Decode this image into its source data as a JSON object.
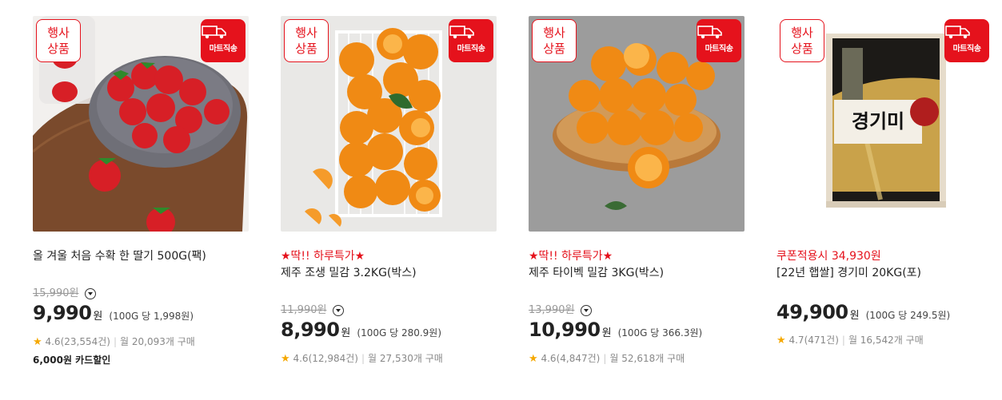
{
  "products": [
    {
      "event_badge": [
        "행사",
        "상품"
      ],
      "delivery_badge": "마트직송",
      "promo": "",
      "title": "올 겨울 처음 수확 한 딸기 500G(팩)",
      "original_price": "15,990원",
      "price": "9,990",
      "currency": "원",
      "unit_price": "(100G 당 1,998원)",
      "rating": "4.6(23,554건)",
      "purchases": "월 20,093개 구매",
      "card_discount": "6,000원 카드할인",
      "image": "strawberries"
    },
    {
      "event_badge": [
        "행사",
        "상품"
      ],
      "delivery_badge": "마트직송",
      "promo": "★딱!! 하루특가★",
      "title": "제주 조생 밀감 3.2KG(박스)",
      "original_price": "11,990원",
      "price": "8,990",
      "currency": "원",
      "unit_price": "(100G 당 280.9원)",
      "rating": "4.6(12,984건)",
      "purchases": "월 27,530개 구매",
      "card_discount": "",
      "image": "tangerines-basket"
    },
    {
      "event_badge": [
        "행사",
        "상품"
      ],
      "delivery_badge": "마트직송",
      "promo": "★딱!! 하루특가★",
      "title": "제주 타이벡 밀감 3KG(박스)",
      "original_price": "13,990원",
      "price": "10,990",
      "currency": "원",
      "unit_price": "(100G 당 366.3원)",
      "rating": "4.6(4,847건)",
      "purchases": "월 52,618개 구매",
      "card_discount": "",
      "image": "tangerines-board"
    },
    {
      "event_badge": [
        "행사",
        "상품"
      ],
      "delivery_badge": "마트직송",
      "promo": "쿠폰적용시 34,930원",
      "title": "[22년 햅쌀] 경기미 20KG(포)",
      "original_price": "",
      "price": "49,900",
      "currency": "원",
      "unit_price": "(100G 당 249.5원)",
      "rating": "4.7(471건)",
      "purchases": "월 16,542개 구매",
      "card_discount": "",
      "image": "rice-bag",
      "rice_label": "경기미"
    }
  ],
  "colors": {
    "accent": "#e5121c",
    "star": "#f5a800"
  }
}
